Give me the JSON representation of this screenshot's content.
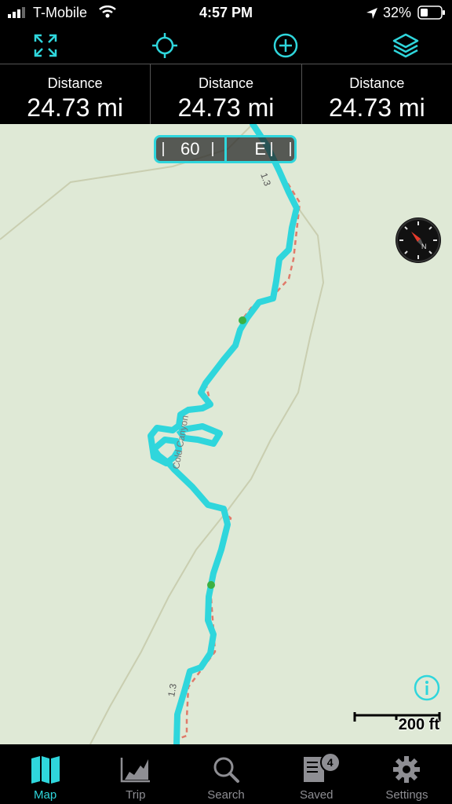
{
  "status": {
    "carrier": "T-Mobile",
    "time": "4:57 PM",
    "battery": "32%"
  },
  "toolbar": {
    "icons": [
      "expand-icon",
      "locate-icon",
      "add-icon",
      "layers-icon"
    ]
  },
  "stats": [
    {
      "label": "Distance",
      "value": "24.73 mi"
    },
    {
      "label": "Distance",
      "value": "24.73 mi"
    },
    {
      "label": "Distance",
      "value": "24.73 mi"
    }
  ],
  "hud": {
    "speed": "60",
    "heading": "E"
  },
  "map": {
    "trail_labels": [
      "1.3",
      "1.3"
    ],
    "road_label": "Cold Canyon",
    "scale_label": "200 ft",
    "route_color": "#2fd6dc",
    "trail_color": "#e07a6a",
    "waypoint_color": "#3cb043"
  },
  "tabs": [
    {
      "label": "Map",
      "icon": "map-icon",
      "active": true
    },
    {
      "label": "Trip",
      "icon": "chart-icon",
      "active": false
    },
    {
      "label": "Search",
      "icon": "search-icon",
      "active": false
    },
    {
      "label": "Saved",
      "icon": "saved-icon",
      "badge": "4",
      "active": false
    },
    {
      "label": "Settings",
      "icon": "gear-icon",
      "active": false
    }
  ]
}
